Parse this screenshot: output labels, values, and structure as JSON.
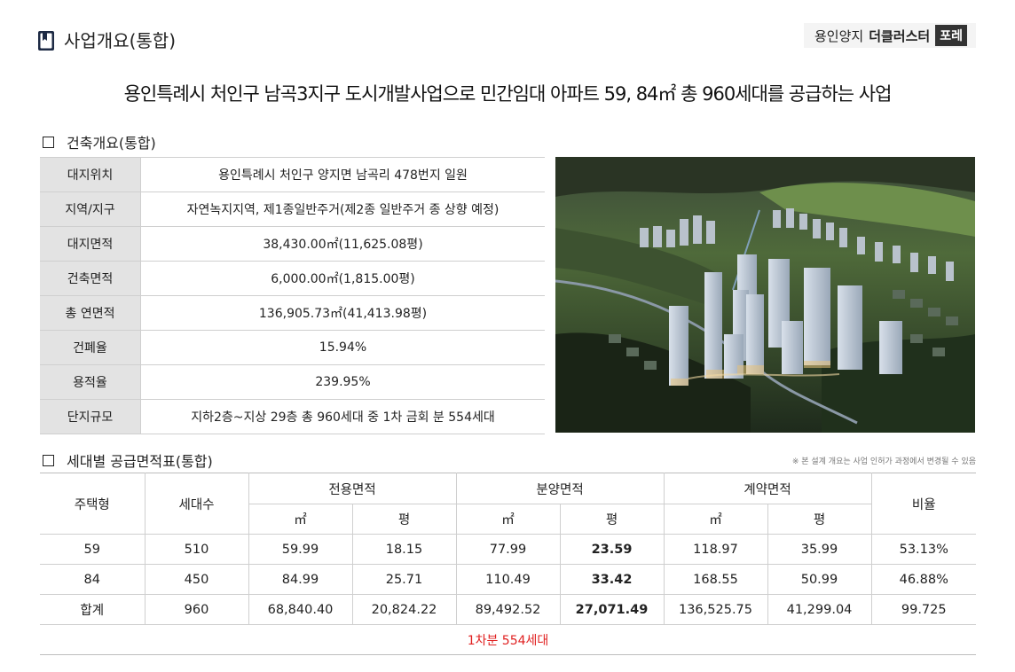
{
  "header": {
    "title": "사업개요(통합)",
    "icon": "bookmark-book-icon",
    "brand": {
      "part1": "용인양지",
      "part2": "더클러스터",
      "part3": "포레"
    }
  },
  "headline": "용인특례시 처인구 남곡3지구 도시개발사업으로 민간임대 아파트 59, 84㎡ 총 960세대를 공급하는 사업",
  "building": {
    "title": "건축개요(통합)",
    "rows": [
      {
        "label": "대지위치",
        "value": "용인특례시 처인구 양지면 남곡리 478번지 일원"
      },
      {
        "label": "지역/지구",
        "value": "자연녹지지역, 제1종일반주거(제2종 일반주거 종 상향 예정)"
      },
      {
        "label": "대지면적",
        "value": "38,430.00㎡(11,625.08평)"
      },
      {
        "label": "건축면적",
        "value": "6,000.00㎡(1,815.00평)"
      },
      {
        "label": "총 연면적",
        "value": "136,905.73㎡(41,413.98평)"
      },
      {
        "label": "건폐율",
        "value": "15.94%"
      },
      {
        "label": "용적율",
        "value": "239.95%"
      },
      {
        "label": "단지규모",
        "value": "지하2층~지상 29층 총 960세대 중 1차 금회 분 554세대"
      }
    ]
  },
  "supply": {
    "title": "세대별 공급면적표(통합)",
    "note": "※ 본 설계 개요는 사업 인허가 과정에서 변경될 수 있음",
    "headers": {
      "type": "주택형",
      "units": "세대수",
      "exclusive": "전용면적",
      "sale": "분양면적",
      "contract": "계약면적",
      "ratio": "비율",
      "sqm": "㎡",
      "pyeong": "평"
    },
    "rows": [
      {
        "type": "59",
        "units": "510",
        "ex_sqm": "59.99",
        "ex_py": "18.15",
        "sale_sqm": "77.99",
        "sale_py": "23.59",
        "con_sqm": "118.97",
        "con_py": "35.99",
        "ratio": "53.13%"
      },
      {
        "type": "84",
        "units": "450",
        "ex_sqm": "84.99",
        "ex_py": "25.71",
        "sale_sqm": "110.49",
        "sale_py": "33.42",
        "con_sqm": "168.55",
        "con_py": "50.99",
        "ratio": "46.88%"
      },
      {
        "type": "합계",
        "units": "960",
        "ex_sqm": "68,840.40",
        "ex_py": "20,824.22",
        "sale_sqm": "89,492.52",
        "sale_py": "27,071.49",
        "con_sqm": "136,525.75",
        "con_py": "41,299.04",
        "ratio": "99.725"
      }
    ],
    "footer": "1차분 554세대"
  },
  "colors": {
    "label_bg": "#e3e3e3",
    "footer_text": "#e02020",
    "border": "#cfcfcf"
  }
}
